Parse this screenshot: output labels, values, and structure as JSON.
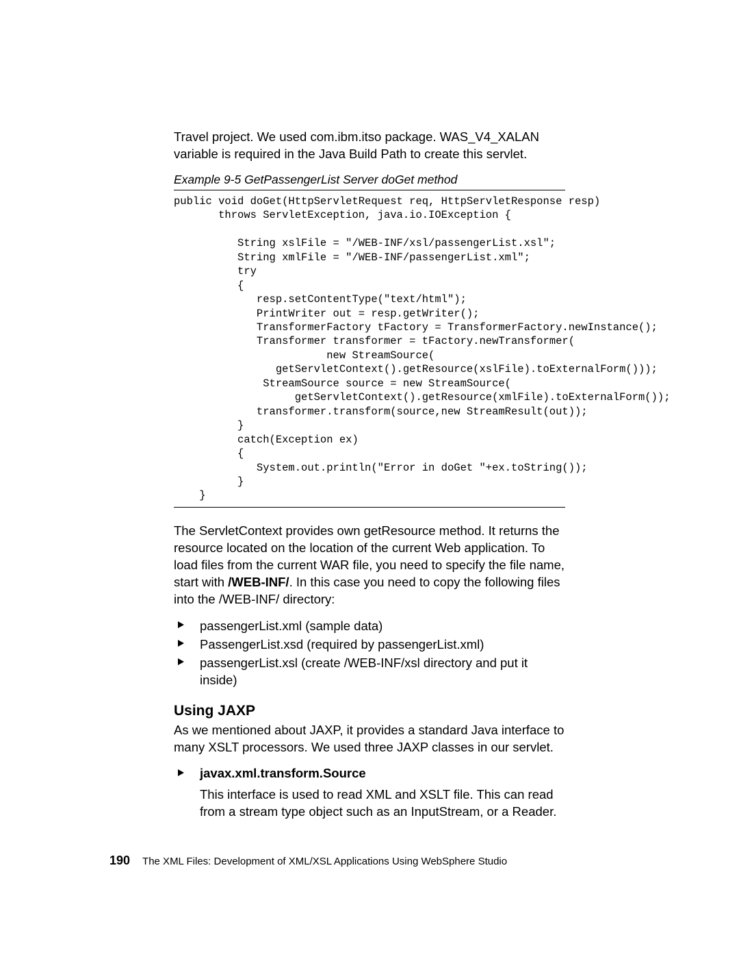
{
  "intro": {
    "p1a": "Travel project. We used com.ibm.itso package. WAS_V4_XALAN variable is required in the Java Build Path to create this servlet."
  },
  "example_caption": "Example 9-5   GetPassengerList Server doGet method",
  "code": "public void doGet(HttpServletRequest req, HttpServletResponse resp)\n       throws ServletException, java.io.IOException {\n\n          String xslFile = \"/WEB-INF/xsl/passengerList.xsl\";\n          String xmlFile = \"/WEB-INF/passengerList.xml\";\n          try\n          {\n             resp.setContentType(\"text/html\");\n             PrintWriter out = resp.getWriter();\n             TransformerFactory tFactory = TransformerFactory.newInstance();\n             Transformer transformer = tFactory.newTransformer(\n                        new StreamSource(\n                getServletContext().getResource(xslFile).toExternalForm()));\n              StreamSource source = new StreamSource(\n                   getServletContext().getResource(xmlFile).toExternalForm());\n             transformer.transform(source,new StreamResult(out));\n          }\n          catch(Exception ex)\n          {\n             System.out.println(\"Error in doGet \"+ex.toString());\n          }\n    }",
  "para2_a": "The ServletContext provides own getResource method. It returns the resource located on the location of the current Web application. To load files from the current WAR file, you need to specify the file name, start with ",
  "para2_bold": "/WEB-INF/",
  "para2_b": ". In this case you need to copy the following files into the /WEB-INF/ directory:",
  "files": [
    "passengerList.xml (sample data)",
    "PassengerList.xsd (required by passengerList.xml)",
    "passengerList.xsl (create /WEB-INF/xsl directory and put it inside)"
  ],
  "heading": "Using JAXP",
  "para3": "As we mentioned about JAXP, it provides a standard Java interface to many XSLT processors. We used three JAXP classes in our servlet.",
  "jaxp_item_title": "javax.xml.transform.Source",
  "jaxp_item_desc": "This interface is used to read XML and XSLT file. This can read from a stream type object such as an InputStream, or a Reader.",
  "footer": {
    "page": "190",
    "title": "The XML Files:  Development of XML/XSL Applications Using WebSphere Studio"
  }
}
